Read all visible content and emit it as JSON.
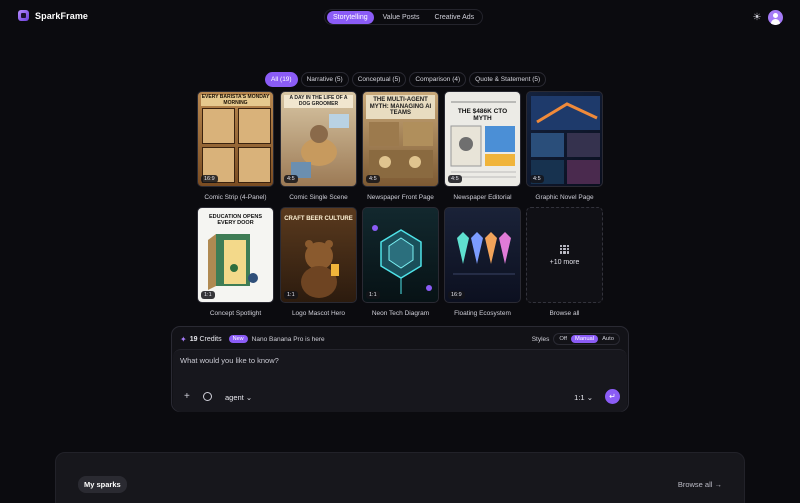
{
  "app": {
    "name": "SparkFrame"
  },
  "header": {
    "tabs": [
      {
        "label": "Storytelling",
        "active": true
      },
      {
        "label": "Value Posts",
        "active": false
      },
      {
        "label": "Creative Ads",
        "active": false
      }
    ]
  },
  "filters": [
    {
      "label": "All (19)",
      "active": true
    },
    {
      "label": "Narrative (5)",
      "active": false
    },
    {
      "label": "Conceptual (5)",
      "active": false
    },
    {
      "label": "Comparison (4)",
      "active": false
    },
    {
      "label": "Quote & Statement (5)",
      "active": false
    }
  ],
  "gallery": [
    {
      "caption": "Comic Strip (4-Panel)",
      "ratio": "16:9",
      "art_text": "EVERY BARISTA'S MONDAY MORNING"
    },
    {
      "caption": "Comic Single Scene",
      "ratio": "4:5",
      "art_text": "A DAY IN THE LIFE OF A DOG GROOMER"
    },
    {
      "caption": "Newspaper Front Page",
      "ratio": "4:5",
      "art_text": "THE MULTI-AGENT MYTH: MANAGING AI TEAMS"
    },
    {
      "caption": "Newspaper Editorial",
      "ratio": "4:5",
      "art_text": "THE $486K CTO MYTH"
    },
    {
      "caption": "Graphic Novel Page",
      "ratio": "4:5",
      "art_text": ""
    },
    {
      "caption": "Concept Spotlight",
      "ratio": "1:1",
      "art_text": "EDUCATION OPENS EVERY DOOR"
    },
    {
      "caption": "Logo Mascot Hero",
      "ratio": "1:1",
      "art_text": "CRAFT BEER CULTURE"
    },
    {
      "caption": "Neon Tech Diagram",
      "ratio": "1:1",
      "art_text": ""
    },
    {
      "caption": "Floating Ecosystem",
      "ratio": "16:9",
      "art_text": ""
    }
  ],
  "more_card": {
    "label": "+10 more",
    "caption": "Browse all"
  },
  "prompt": {
    "credits_count": "19",
    "credits_label": "Credits",
    "new_badge": "New",
    "announcement": "Nano Banana Pro is here",
    "styles_label": "Styles",
    "style_options": [
      {
        "label": "Off",
        "active": false
      },
      {
        "label": "Manual",
        "active": true
      },
      {
        "label": "Auto",
        "active": false
      }
    ],
    "placeholder": "What would you like to know?",
    "mode": "agent",
    "aspect_ratio": "1:1"
  },
  "bottom": {
    "my_sparks": "My sparks",
    "browse_all": "Browse all →"
  },
  "colors": {
    "accent": "#8b5cf6",
    "background": "#0b0b0f"
  }
}
